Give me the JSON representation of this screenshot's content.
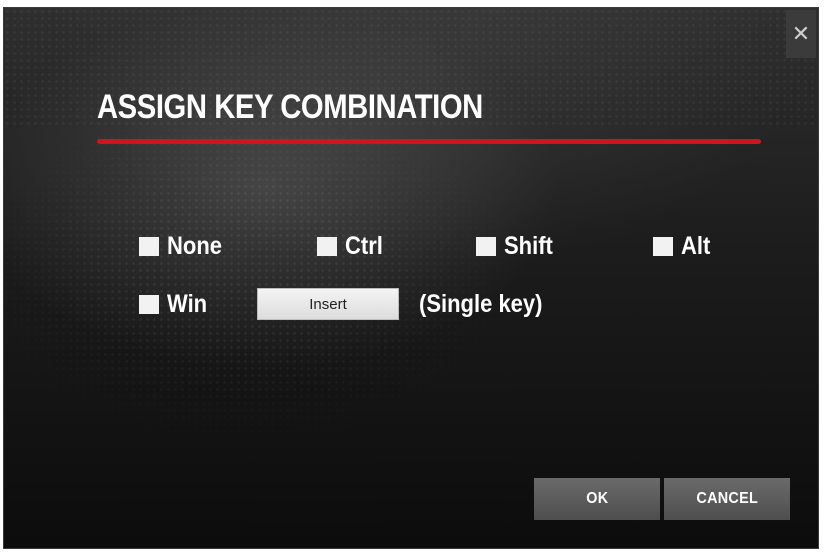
{
  "dialog": {
    "title": "ASSIGN KEY COMBINATION",
    "close_glyph": "✕",
    "accent_color": "#d0141b"
  },
  "modifiers": [
    {
      "label": "None",
      "checked": false
    },
    {
      "label": "Ctrl",
      "checked": false
    },
    {
      "label": "Shift",
      "checked": false
    },
    {
      "label": "Alt",
      "checked": false
    },
    {
      "label": "Win",
      "checked": false
    }
  ],
  "key_field": {
    "value": "Insert",
    "hint": "(Single key)"
  },
  "buttons": {
    "ok": "OK",
    "cancel": "CANCEL"
  }
}
